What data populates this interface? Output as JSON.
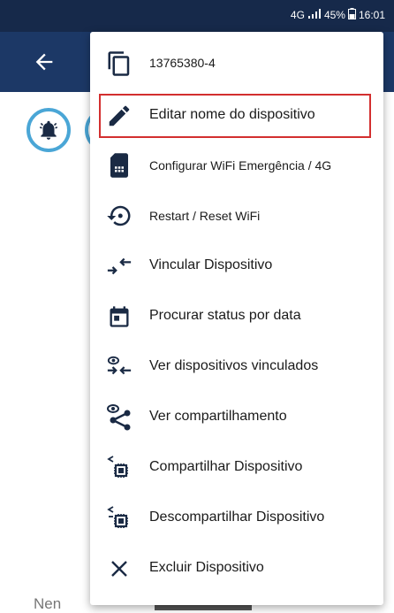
{
  "status_bar": {
    "network": "4G",
    "battery": "45%",
    "time": "16:01"
  },
  "menu": {
    "items": [
      {
        "label": "13765380-4",
        "icon": "copy-icon"
      },
      {
        "label": "Editar nome do dispositivo",
        "icon": "pencil-icon"
      },
      {
        "label": "Configurar WiFi Emergência / 4G",
        "icon": "sim-card-icon"
      },
      {
        "label": "Restart / Reset WiFi",
        "icon": "restore-icon"
      },
      {
        "label": "Vincular Dispositivo",
        "icon": "link-arrows-icon"
      },
      {
        "label": "Procurar status por data",
        "icon": "calendar-icon"
      },
      {
        "label": "Ver dispositivos vinculados",
        "icon": "view-linked-icon"
      },
      {
        "label": "Ver compartilhamento",
        "icon": "view-share-icon"
      },
      {
        "label": "Compartilhar Dispositivo",
        "icon": "share-chip-icon"
      },
      {
        "label": "Descompartilhar Dispositivo",
        "icon": "unshare-chip-icon"
      },
      {
        "label": "Excluir Dispositivo",
        "icon": "close-icon"
      }
    ]
  },
  "background": {
    "bottom_text": "Nen"
  },
  "colors": {
    "statusbar": "#16294a",
    "appbar": "#1c3866",
    "accent_circle": "#4aa6d6",
    "highlight": "#d32f2f",
    "icon": "#1a2a44"
  }
}
